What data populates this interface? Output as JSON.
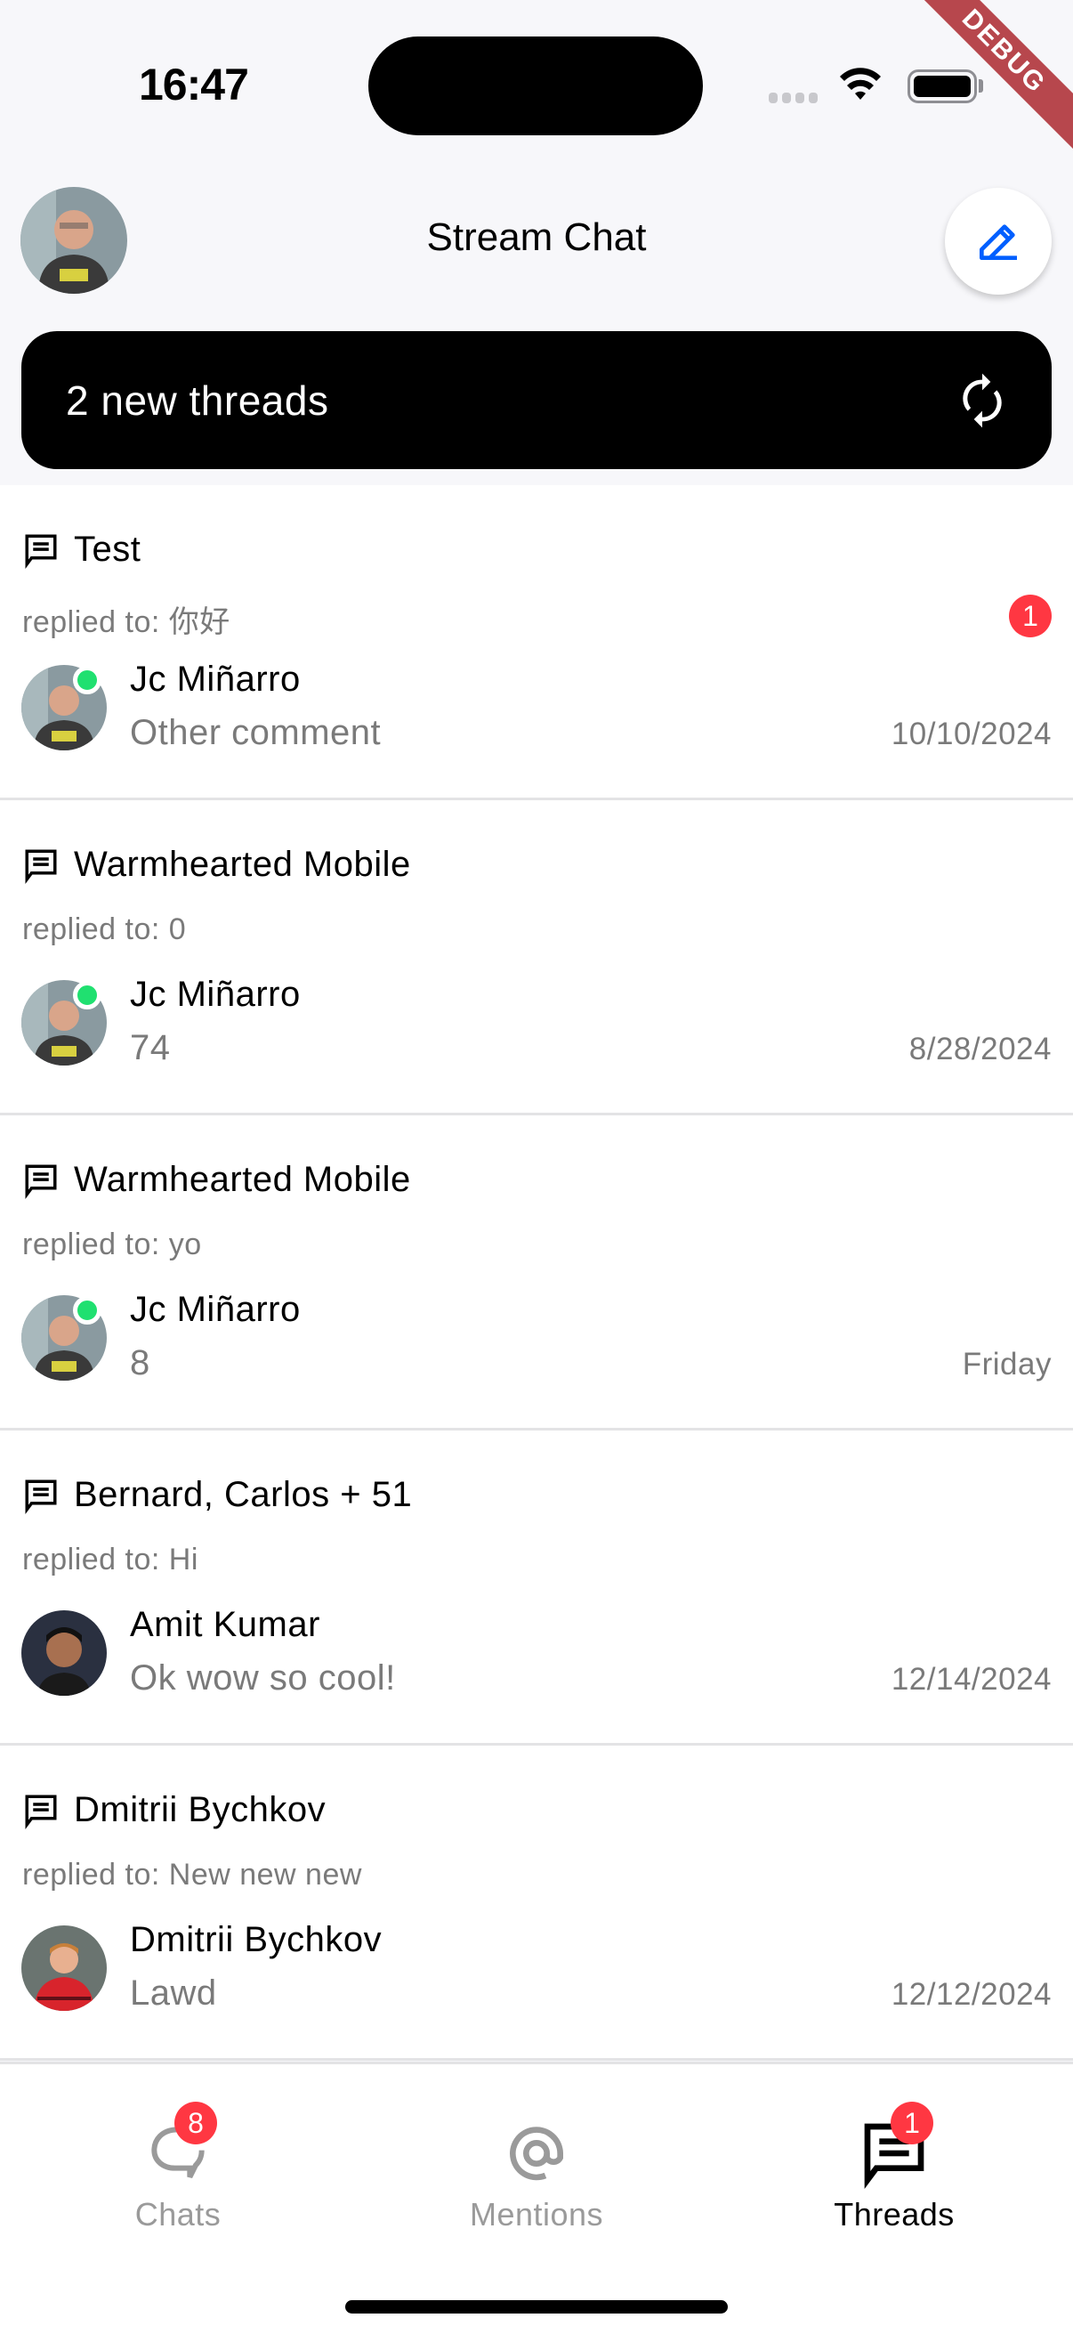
{
  "status_bar": {
    "time": "16:47",
    "debug_label": "DEBUG"
  },
  "header": {
    "title": "Stream Chat",
    "compose_icon": "pencil-icon",
    "avatar_alt": "current user avatar"
  },
  "banner": {
    "text": "2 new threads",
    "icon": "refresh-icon"
  },
  "colors": {
    "accent": "#005fff",
    "badge": "#ff3742",
    "online": "#20e070",
    "secondary_text": "#7a7a7a"
  },
  "threads": [
    {
      "title": "Test",
      "replied_to": "replied to: 你好",
      "unread": "1",
      "author": "Jc Miñarro",
      "online": true,
      "preview": "Other comment",
      "date": "10/10/2024"
    },
    {
      "title": "Warmhearted Mobile",
      "replied_to": "replied to: 0",
      "unread": null,
      "author": "Jc Miñarro",
      "online": true,
      "preview": "74",
      "date": "8/28/2024"
    },
    {
      "title": "Warmhearted Mobile",
      "replied_to": "replied to: yo",
      "unread": null,
      "author": "Jc Miñarro",
      "online": true,
      "preview": "8",
      "date": "Friday"
    },
    {
      "title": "Bernard, Carlos + 51",
      "replied_to": "replied to: Hi",
      "unread": null,
      "author": "Amit Kumar",
      "online": false,
      "preview": "Ok wow so cool!",
      "date": "12/14/2024"
    },
    {
      "title": "Dmitrii Bychkov",
      "replied_to": "replied to: New new new",
      "unread": null,
      "author": "Dmitrii Bychkov",
      "online": false,
      "preview": "Lawd",
      "date": "12/12/2024"
    }
  ],
  "bottom_nav": [
    {
      "label": "Chats",
      "icon": "chat-bubble-icon",
      "badge": "8",
      "active": false
    },
    {
      "label": "Mentions",
      "icon": "at-sign-icon",
      "badge": null,
      "active": false
    },
    {
      "label": "Threads",
      "icon": "threads-icon",
      "badge": "1",
      "active": true
    }
  ]
}
